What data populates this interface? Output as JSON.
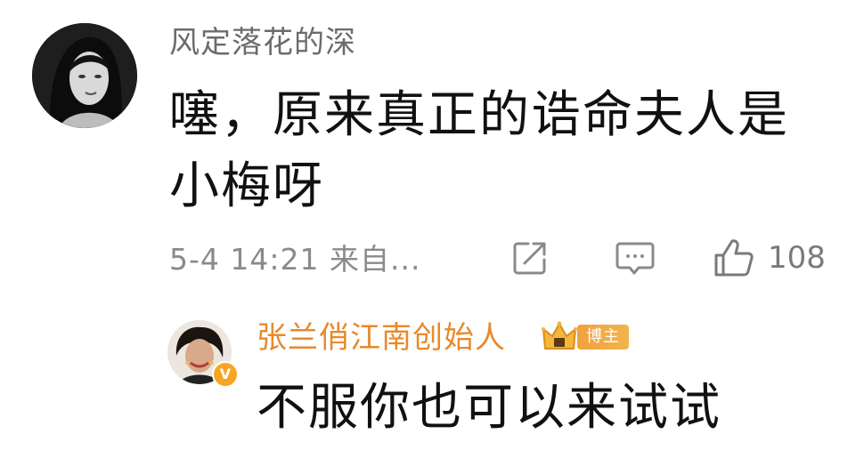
{
  "comment": {
    "username": "风定落花的深",
    "text": "噻，原来真正的诰命夫人是小梅呀",
    "timestamp": "5-4 14:21 来自...",
    "like_count": "108",
    "icons": {
      "share": "share-icon",
      "reply": "comment-icon",
      "like": "thumbs-up-icon"
    }
  },
  "reply": {
    "username": "张兰俏江南创始人",
    "badge_label": "博主",
    "verified_mark": "V",
    "text": "不服你也可以来试试",
    "icons": {
      "crown": "crown-icon",
      "verified": "verified-icon"
    }
  },
  "colors": {
    "username_gray": "#6b6b6b",
    "meta_gray": "#8a8a8a",
    "reply_username_orange": "#e8892c",
    "badge_orange": "#f3a03e",
    "text_black": "#111111"
  }
}
